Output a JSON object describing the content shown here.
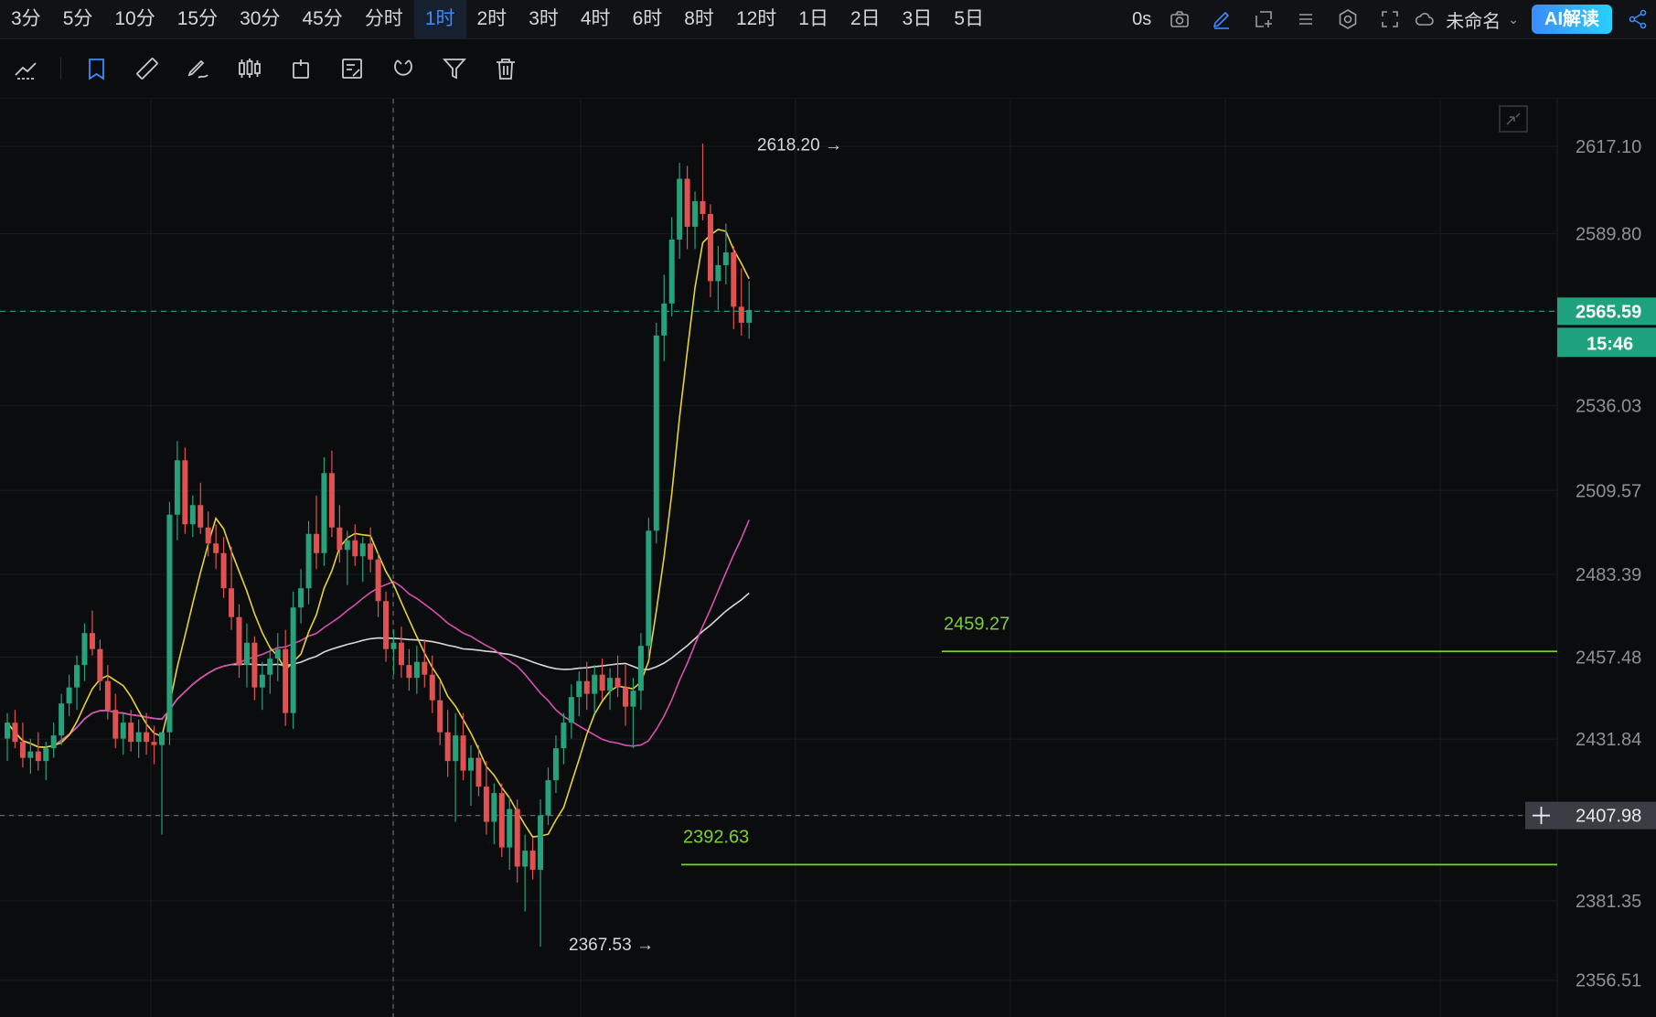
{
  "timeframes": [
    "3分",
    "5分",
    "10分",
    "15分",
    "30分",
    "45分",
    "分时",
    "1时",
    "2时",
    "3时",
    "4时",
    "6时",
    "8时",
    "12时",
    "1日",
    "2日",
    "3日",
    "5日"
  ],
  "active_timeframe": "1时",
  "topbar": {
    "countdown": "0s",
    "layout_name": "未命名",
    "ai_button": "AI解读",
    "icons": [
      "camera-icon",
      "pencil-icon",
      "add-window-icon",
      "list-icon",
      "settings-icon",
      "fullscreen-icon",
      "cloud-icon",
      "share-icon"
    ]
  },
  "drawing_tools": [
    "trendline-icon",
    "bookmark-icon",
    "ruler-icon",
    "pen-icon",
    "candles-icon",
    "lock-icon",
    "note-icon",
    "magnet-icon",
    "filter-icon",
    "trash-icon"
  ],
  "colors": {
    "up": "#26a17a",
    "down": "#e05252",
    "ma_short": "#e8d23a",
    "ma_mid": "#d94fb3",
    "ma_long": "#d8d8d8",
    "level": "#7ad135",
    "current": "#1fa37e"
  },
  "price_axis": {
    "ticks": [
      "2617.10",
      "2589.80",
      "2565.59",
      "2536.03",
      "2509.57",
      "2483.39",
      "2457.48",
      "2431.84",
      "2407.98",
      "2381.35",
      "2356.51"
    ],
    "current_price": "2565.59",
    "countdown": "15:46",
    "crosshair_price": "2407.98"
  },
  "annotations": {
    "high": "2618.20 →",
    "low": "2367.53 →",
    "resistance": "2459.27",
    "support": "2392.63"
  },
  "chart_data": {
    "type": "candlestick",
    "interval": "1时",
    "ylim": [
      2345,
      2632
    ],
    "candles": [
      [
        2432,
        2440,
        2425,
        2437
      ],
      [
        2437,
        2441,
        2429,
        2431
      ],
      [
        2431,
        2437,
        2423,
        2426
      ],
      [
        2426,
        2432,
        2421,
        2428
      ],
      [
        2428,
        2434,
        2422,
        2425
      ],
      [
        2425,
        2431,
        2419,
        2429
      ],
      [
        2429,
        2437,
        2426,
        2433
      ],
      [
        2433,
        2446,
        2430,
        2443
      ],
      [
        2443,
        2452,
        2439,
        2448
      ],
      [
        2448,
        2458,
        2441,
        2455
      ],
      [
        2455,
        2468,
        2450,
        2465
      ],
      [
        2465,
        2472,
        2458,
        2460
      ],
      [
        2460,
        2463,
        2447,
        2450
      ],
      [
        2450,
        2455,
        2438,
        2441
      ],
      [
        2441,
        2446,
        2429,
        2432
      ],
      [
        2432,
        2440,
        2427,
        2437
      ],
      [
        2437,
        2441,
        2428,
        2431
      ],
      [
        2431,
        2438,
        2426,
        2434
      ],
      [
        2434,
        2440,
        2427,
        2431
      ],
      [
        2431,
        2436,
        2424,
        2430
      ],
      [
        2430,
        2433,
        2402,
        2434
      ],
      [
        2434,
        2506,
        2430,
        2502
      ],
      [
        2502,
        2525,
        2494,
        2519
      ],
      [
        2519,
        2523,
        2496,
        2499
      ],
      [
        2499,
        2508,
        2495,
        2505
      ],
      [
        2505,
        2512,
        2496,
        2498
      ],
      [
        2498,
        2503,
        2489,
        2493
      ],
      [
        2493,
        2499,
        2485,
        2490
      ],
      [
        2490,
        2495,
        2476,
        2479
      ],
      [
        2479,
        2492,
        2466,
        2470
      ],
      [
        2470,
        2474,
        2451,
        2455
      ],
      [
        2455,
        2468,
        2448,
        2462
      ],
      [
        2462,
        2464,
        2444,
        2448
      ],
      [
        2448,
        2456,
        2441,
        2452
      ],
      [
        2452,
        2460,
        2446,
        2457
      ],
      [
        2457,
        2465,
        2450,
        2460
      ],
      [
        2460,
        2466,
        2436,
        2440
      ],
      [
        2440,
        2478,
        2435,
        2473
      ],
      [
        2473,
        2485,
        2468,
        2479
      ],
      [
        2479,
        2500,
        2474,
        2496
      ],
      [
        2496,
        2508,
        2485,
        2490
      ],
      [
        2490,
        2520,
        2486,
        2515
      ],
      [
        2515,
        2522,
        2495,
        2498
      ],
      [
        2498,
        2505,
        2487,
        2491
      ],
      [
        2491,
        2497,
        2480,
        2494
      ],
      [
        2494,
        2499,
        2486,
        2489
      ],
      [
        2489,
        2495,
        2481,
        2493
      ],
      [
        2493,
        2498,
        2484,
        2488
      ],
      [
        2488,
        2490,
        2470,
        2475
      ],
      [
        2475,
        2478,
        2456,
        2460
      ],
      [
        2460,
        2466,
        2452,
        2462
      ],
      [
        2462,
        2467,
        2451,
        2455
      ],
      [
        2455,
        2460,
        2447,
        2451
      ],
      [
        2451,
        2461,
        2446,
        2456
      ],
      [
        2456,
        2463,
        2448,
        2452
      ],
      [
        2452,
        2458,
        2440,
        2444
      ],
      [
        2444,
        2450,
        2430,
        2434
      ],
      [
        2434,
        2441,
        2420,
        2425
      ],
      [
        2425,
        2440,
        2406,
        2433
      ],
      [
        2433,
        2440,
        2419,
        2422
      ],
      [
        2422,
        2430,
        2411,
        2426
      ],
      [
        2426,
        2430,
        2414,
        2417
      ],
      [
        2417,
        2425,
        2402,
        2406
      ],
      [
        2406,
        2418,
        2399,
        2415
      ],
      [
        2415,
        2418,
        2395,
        2398
      ],
      [
        2398,
        2414,
        2391,
        2410
      ],
      [
        2410,
        2413,
        2387,
        2392
      ],
      [
        2392,
        2402,
        2378,
        2397
      ],
      [
        2397,
        2401,
        2388,
        2391
      ],
      [
        2391,
        2413,
        2367,
        2408
      ],
      [
        2408,
        2423,
        2405,
        2419
      ],
      [
        2419,
        2433,
        2415,
        2429
      ],
      [
        2429,
        2440,
        2424,
        2437
      ],
      [
        2437,
        2449,
        2432,
        2445
      ],
      [
        2445,
        2453,
        2439,
        2450
      ],
      [
        2450,
        2456,
        2441,
        2446
      ],
      [
        2446,
        2455,
        2440,
        2452
      ],
      [
        2452,
        2457,
        2444,
        2447
      ],
      [
        2447,
        2454,
        2441,
        2451
      ],
      [
        2451,
        2458,
        2445,
        2448
      ],
      [
        2448,
        2455,
        2436,
        2442
      ],
      [
        2442,
        2451,
        2429,
        2447
      ],
      [
        2447,
        2465,
        2441,
        2461
      ],
      [
        2461,
        2501,
        2457,
        2497
      ],
      [
        2497,
        2562,
        2493,
        2558
      ],
      [
        2558,
        2577,
        2550,
        2568
      ],
      [
        2568,
        2595,
        2564,
        2588
      ],
      [
        2588,
        2612,
        2582,
        2607
      ],
      [
        2607,
        2611,
        2585,
        2592
      ],
      [
        2592,
        2603,
        2585,
        2600
      ],
      [
        2600,
        2618,
        2594,
        2596
      ],
      [
        2596,
        2599,
        2570,
        2575
      ],
      [
        2575,
        2586,
        2566,
        2580
      ],
      [
        2580,
        2593,
        2574,
        2584
      ],
      [
        2584,
        2586,
        2560,
        2567
      ],
      [
        2567,
        2579,
        2558,
        2562
      ],
      [
        2562,
        2575,
        2557,
        2566
      ]
    ],
    "ma_short_last": 2548,
    "levels": [
      2459.27,
      2392.63
    ]
  }
}
